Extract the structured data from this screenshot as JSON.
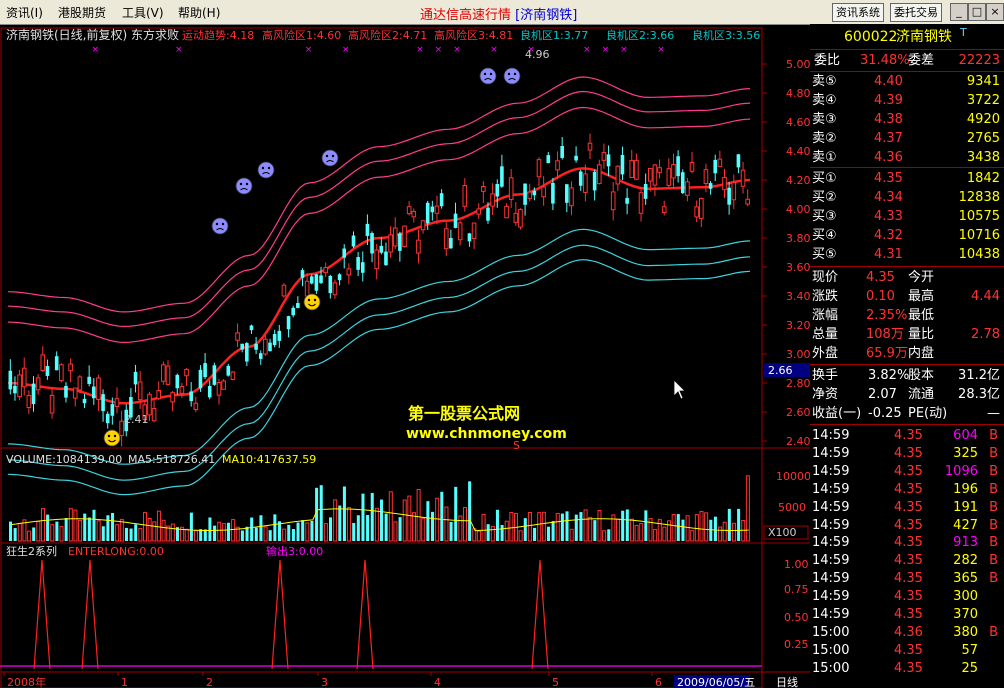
{
  "menu": {
    "items": [
      "资讯(I)",
      "港股期货",
      "工具(V)",
      "帮助(H)"
    ],
    "app_title": "通达信高速行情",
    "stock_tag": "[济南钢铁]",
    "btn_info": "资讯系统",
    "btn_trade": "委托交易",
    "win_min": "_",
    "win_max": "□",
    "win_close": "×"
  },
  "header": {
    "title": "济南钢铁(日线,前复权) 东方求败",
    "indicators": [
      "运动趋势:4.18",
      "高风险区1:4.60",
      "高风险区2:4.71",
      "高风险区3:4.81",
      "良机区1:3.77",
      "良机区2:3.66",
      "良机区3:3.56"
    ],
    "indicator_colors": [
      "#ff3232",
      "#ff3232",
      "#ff3232",
      "#ff3232",
      "#00c8c8",
      "#00c8c8",
      "#00c8c8"
    ]
  },
  "price_axis": [
    "5.00",
    "4.80",
    "4.60",
    "4.40",
    "4.20",
    "4.00",
    "3.80",
    "3.60",
    "3.40",
    "3.20",
    "3.00",
    "2.80",
    "2.60",
    "2.40"
  ],
  "current_price_tag": "2.66",
  "annotations": {
    "high": "4.96",
    "low": "2.41",
    "s_mark": "S"
  },
  "volume": {
    "label": "VOLUME:1084139.00",
    "ma5": "MA5:518726.41",
    "ma10": "MA10:417637.59",
    "axis": [
      "10000",
      "5000"
    ],
    "unit": "X100"
  },
  "signal": {
    "name": "狂生2系列",
    "enterlong": "ENTERLONG:0.00",
    "output": "输出3:0.00",
    "axis": [
      "1.00",
      "0.75",
      "0.50",
      "0.25"
    ]
  },
  "date_axis": {
    "labels": [
      "2008年",
      "1",
      "2",
      "3",
      "4",
      "5",
      "6"
    ],
    "current_date": "2009/06/05/五",
    "period": "日线"
  },
  "watermark": {
    "line1": "第一股票公式网",
    "line2": "www.chnmoney.com"
  },
  "quote": {
    "code": "600022",
    "name": "济南钢铁",
    "flag": "T",
    "weibi_label": "委比",
    "weibi_value": "31.48%",
    "weicha_label": "委差",
    "weicha_value": "22223",
    "sells": [
      {
        "label": "卖⑤",
        "price": "4.40",
        "vol": "9341"
      },
      {
        "label": "卖④",
        "price": "4.39",
        "vol": "3722"
      },
      {
        "label": "卖③",
        "price": "4.38",
        "vol": "4920"
      },
      {
        "label": "卖②",
        "price": "4.37",
        "vol": "2765"
      },
      {
        "label": "卖①",
        "price": "4.36",
        "vol": "3438"
      }
    ],
    "buys": [
      {
        "label": "买①",
        "price": "4.35",
        "vol": "1842"
      },
      {
        "label": "买②",
        "price": "4.34",
        "vol": "12838"
      },
      {
        "label": "买③",
        "price": "4.33",
        "vol": "10575"
      },
      {
        "label": "买④",
        "price": "4.32",
        "vol": "10716"
      },
      {
        "label": "买⑤",
        "price": "4.31",
        "vol": "10438"
      }
    ],
    "stats": [
      {
        "l1": "现价",
        "v1": "4.35",
        "l2": "今开",
        "v2": ""
      },
      {
        "l1": "涨跌",
        "v1": "0.10",
        "l2": "最高",
        "v2": "4.44"
      },
      {
        "l1": "涨幅",
        "v1": "2.35%",
        "l2": "最低",
        "v2": ""
      },
      {
        "l1": "总量",
        "v1": "108万",
        "l2": "量比",
        "v2": "2.78"
      },
      {
        "l1": "外盘",
        "v1": "65.9万",
        "l2": "内盘",
        "v2": ""
      }
    ],
    "stats2": [
      {
        "l1": "换手",
        "v1": "3.82%",
        "l2": "股本",
        "v2": "31.2亿"
      },
      {
        "l1": "净资",
        "v1": "2.07",
        "l2": "流通",
        "v2": "28.3亿"
      },
      {
        "l1": "收益(一)",
        "v1": "-0.25",
        "l2": "PE(动)",
        "v2": "—"
      }
    ],
    "ticks": [
      {
        "time": "14:59",
        "price": "4.35",
        "vol": "604",
        "side": "B",
        "hl": true
      },
      {
        "time": "14:59",
        "price": "4.35",
        "vol": "325",
        "side": "B",
        "hl": false
      },
      {
        "time": "14:59",
        "price": "4.35",
        "vol": "1096",
        "side": "B",
        "hl": true
      },
      {
        "time": "14:59",
        "price": "4.35",
        "vol": "196",
        "side": "B",
        "hl": false
      },
      {
        "time": "14:59",
        "price": "4.35",
        "vol": "191",
        "side": "B",
        "hl": false
      },
      {
        "time": "14:59",
        "price": "4.35",
        "vol": "427",
        "side": "B",
        "hl": false
      },
      {
        "time": "14:59",
        "price": "4.35",
        "vol": "913",
        "side": "B",
        "hl": true
      },
      {
        "time": "14:59",
        "price": "4.35",
        "vol": "282",
        "side": "B",
        "hl": false
      },
      {
        "time": "14:59",
        "price": "4.35",
        "vol": "365",
        "side": "B",
        "hl": false
      },
      {
        "time": "14:59",
        "price": "4.35",
        "vol": "300",
        "side": "",
        "hl": false
      },
      {
        "time": "14:59",
        "price": "4.35",
        "vol": "370",
        "side": "",
        "hl": false
      },
      {
        "time": "15:00",
        "price": "4.36",
        "vol": "380",
        "side": "B",
        "hl": false
      },
      {
        "time": "15:00",
        "price": "4.35",
        "vol": "57",
        "side": "",
        "hl": false
      },
      {
        "time": "15:00",
        "price": "4.35",
        "vol": "25",
        "side": "",
        "hl": false
      }
    ]
  },
  "colors": {
    "up": "#ff3232",
    "down": "#54ffff",
    "trend": "#ff2020",
    "risk": "#ff3c8c",
    "chance": "#3cd2dc",
    "grid": "#a00000"
  }
}
